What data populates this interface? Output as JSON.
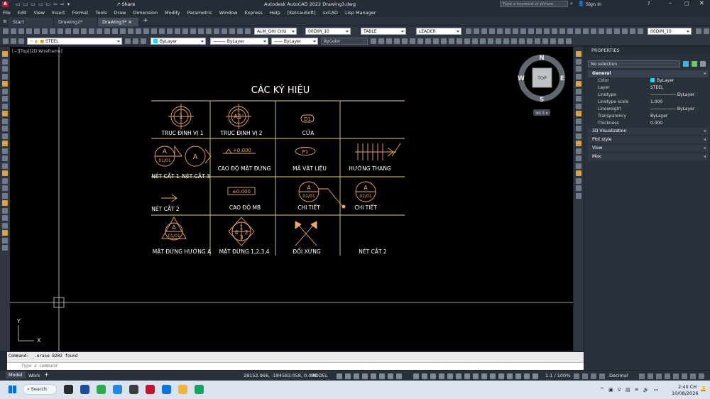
{
  "app": {
    "title": "Autodesk AutoCAD 2022   Drawing3.dwg",
    "share_label": "Share",
    "search_placeholder": "Type a keyword or phrase",
    "sign_in": "Sign In"
  },
  "menu": [
    "File",
    "Edit",
    "View",
    "Insert",
    "Format",
    "Tools",
    "Draw",
    "Dimension",
    "Modify",
    "Parametric",
    "Window",
    "Express",
    "Help",
    "[KetcauSoft]",
    "sxCAD",
    "Lisp Manager"
  ],
  "tabs": [
    {
      "label": "Start"
    },
    {
      "label": "Drawing2*"
    },
    {
      "label": "Drawing3*"
    }
  ],
  "toolbar1": {
    "text_style": "ALM_GHI CHU",
    "dim_style": "00DIM_10",
    "table_style": "TABLE",
    "mleader_style": "LEADER",
    "right_dim_style": "00DIM_10"
  },
  "toolbar2": {
    "layer": "STEEL",
    "color": "ByLayer",
    "linetype": "ByLayer",
    "lineweight": "ByLayer",
    "plot_style": "ByColor"
  },
  "viewport": {
    "label": "[−][Top][2D Wireframe]",
    "viewcube": {
      "n": "N",
      "s": "S",
      "e": "E",
      "w": "W",
      "top": "TOP",
      "wcs": "WCS ▾"
    },
    "ucs": {
      "x": "X",
      "y": "Y"
    }
  },
  "drawing": {
    "title": "CÁC KÝ HIỆU",
    "cells": {
      "r1c1": "TRỤC ĐỊNH VỊ 1",
      "r1c2": "TRỤC ĐỊNH VỊ 2",
      "r1c3": "CỬA",
      "r2c1a": "NÉT CẮT 1",
      "r2c1b": "NÉT CẮT 3",
      "r2c2": "CAO ĐỘ MẶT ĐỨNG",
      "r2c3": "MÃ VẬT LIỆU",
      "r2c4": "HƯỚNG THANG",
      "r3c1": "NÉT CẮT 2",
      "r3c2": "CAO ĐỘ MB",
      "r3c3": "CHI TIẾT",
      "r3c4": "CHI TIẾT",
      "r4c1": "MẶT ĐỨNG HƯỚNG A",
      "r4c2": "MẶT ĐỨNG 1,2,3,4",
      "r4c3": "ĐỐI XỨNG",
      "r4c4": "NÉT CẮT 2"
    },
    "sym": {
      "one": "1",
      "a1": "A1'",
      "d1": "D1",
      "a": "A",
      "ref": "01/01",
      "elev": "+0.000",
      "pm": "±0.000",
      "p1": "P1",
      "n1": "1",
      "n2": "2",
      "n3": "3",
      "n4": "4"
    }
  },
  "properties": {
    "title": "PROPERTIES",
    "selection": "No selection",
    "sections": {
      "general": "General",
      "viz": "3D Visualization",
      "plot": "Plot style",
      "view": "View",
      "misc": "Misc"
    },
    "rows": [
      {
        "k": "Color",
        "v": "ByLayer"
      },
      {
        "k": "Layer",
        "v": "STEEL"
      },
      {
        "k": "Linetype",
        "v": "ByLayer"
      },
      {
        "k": "Linetype scale",
        "v": "1.000"
      },
      {
        "k": "Lineweight",
        "v": "ByLayer"
      },
      {
        "k": "Transparency",
        "v": "ByLayer"
      },
      {
        "k": "Thickness",
        "v": "0.000"
      }
    ]
  },
  "command": {
    "history": "Command: _.erase 8202 found",
    "placeholder": "Type a command"
  },
  "status": {
    "model_tab": "Model",
    "work_tab": "Work",
    "coords": "28152.966, -184583.058, 0.000",
    "space": "MODEL",
    "scale": "1:1 / 100%",
    "units": "Decimal"
  },
  "taskbar": {
    "search": "Search",
    "time": "2:40 CH",
    "date": "10/08/2026"
  },
  "colors": {
    "drawing_line": "#f0a868",
    "table_line": "#e8d27a",
    "canvas": "#000000",
    "accent": "#3c8fd8"
  }
}
